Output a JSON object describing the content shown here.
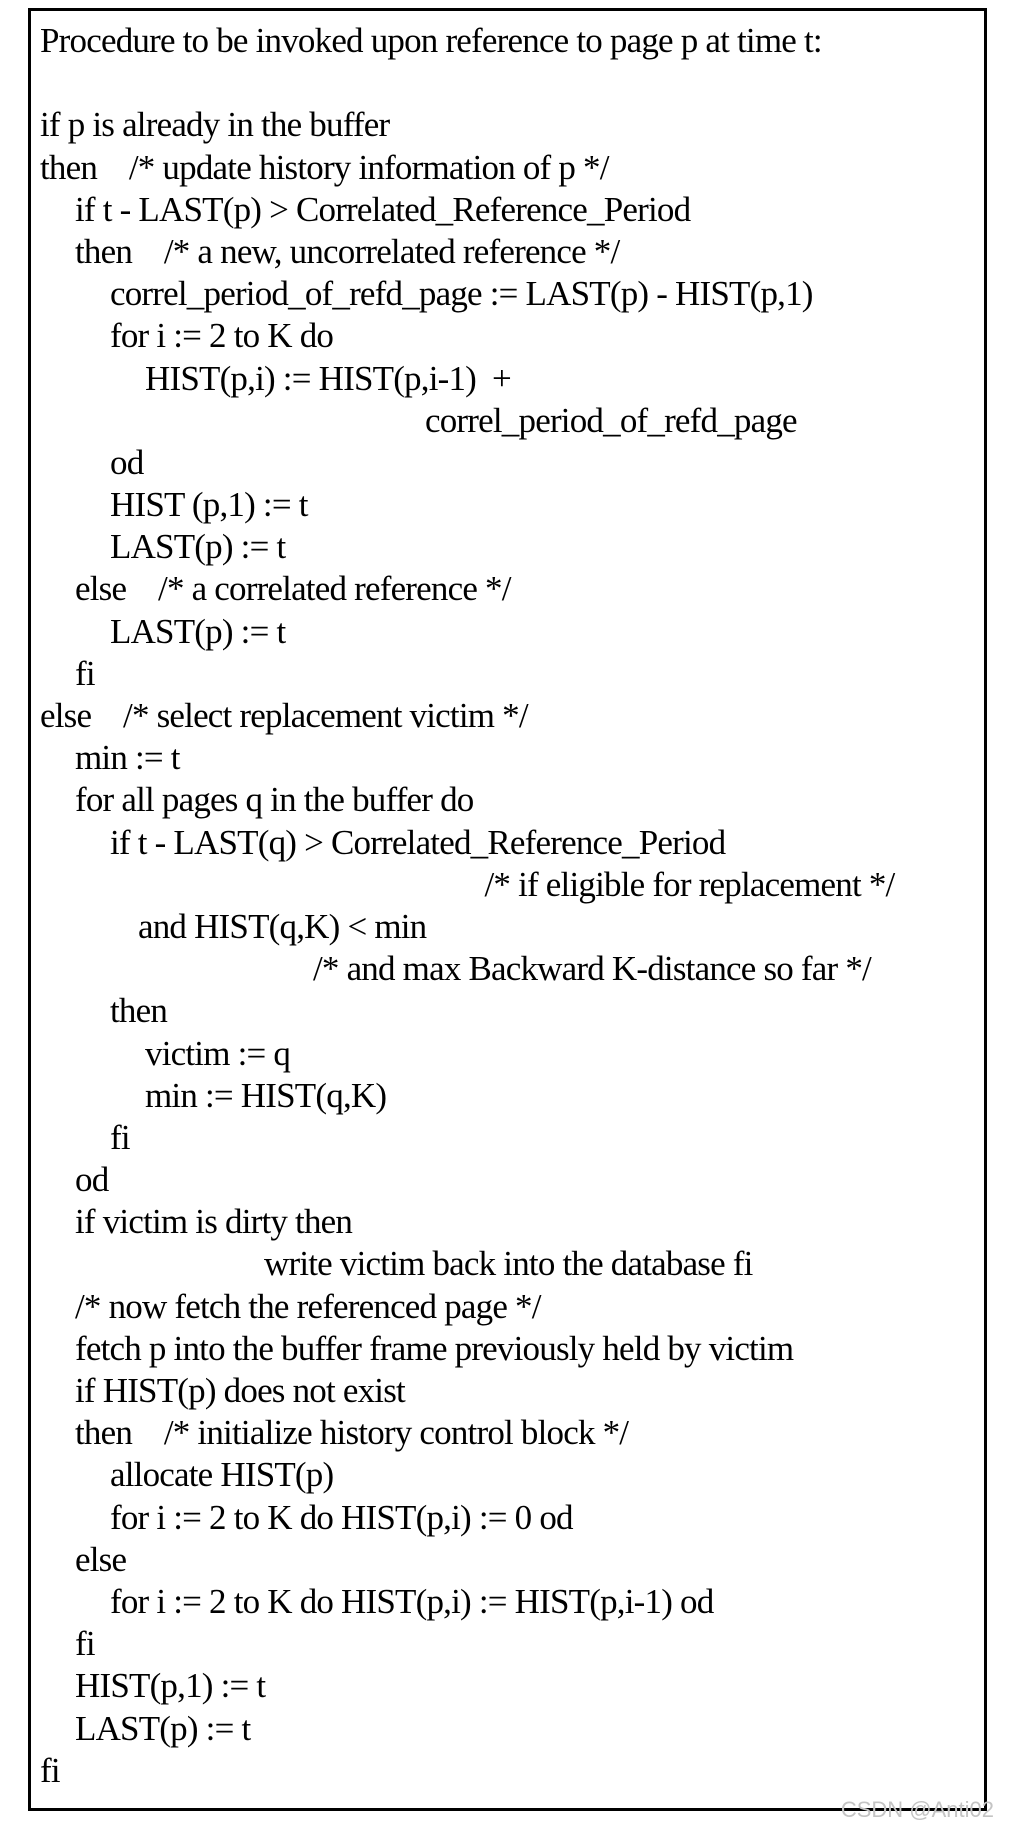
{
  "lines": [
    {
      "indent": 0,
      "text": "Procedure to be invoked upon reference to page p at time t:"
    },
    {
      "indent": 0,
      "text": ""
    },
    {
      "indent": 0,
      "text": "if p is already in the buffer"
    },
    {
      "indent": 0,
      "text": "then    /* update history information of p */"
    },
    {
      "indent": 1,
      "text": "if t - LAST(p) > Correlated_Reference_Period"
    },
    {
      "indent": 1,
      "text": "then    /* a new, uncorrelated reference */"
    },
    {
      "indent": 2,
      "text": "correl_period_of_refd_page := LAST(p) - HIST(p,1)"
    },
    {
      "indent": 2,
      "text": "for i := 2 to K do"
    },
    {
      "indent": 3,
      "text": "HIST(p,i) := HIST(p,i-1)  +"
    },
    {
      "indent": 11,
      "text": "correl_period_of_refd_page"
    },
    {
      "indent": 2,
      "text": "od"
    },
    {
      "indent": 2,
      "text": "HIST (p,1) := t"
    },
    {
      "indent": 2,
      "text": "LAST(p) := t"
    },
    {
      "indent": 1,
      "text": "else    /* a correlated reference */"
    },
    {
      "indent": 2,
      "text": "LAST(p) := t"
    },
    {
      "indent": 1,
      "text": "fi"
    },
    {
      "indent": 0,
      "text": "else    /* select replacement victim */"
    },
    {
      "indent": 1,
      "text": "min := t"
    },
    {
      "indent": 1,
      "text": "for all pages q in the buffer do"
    },
    {
      "indent": 2,
      "text": "if t - LAST(q) > Correlated_Reference_Period"
    },
    {
      "indent": 12.7,
      "text": "/* if eligible for replacement */"
    },
    {
      "indent": 2.8,
      "text": "and HIST(q,K) < min"
    },
    {
      "indent": 7.8,
      "text": "/* and max Backward K-distance so far */"
    },
    {
      "indent": 2,
      "text": "then"
    },
    {
      "indent": 3,
      "text": "victim := q"
    },
    {
      "indent": 3,
      "text": "min := HIST(q,K)"
    },
    {
      "indent": 2,
      "text": "fi"
    },
    {
      "indent": 1,
      "text": "od"
    },
    {
      "indent": 1,
      "text": "if victim is dirty then"
    },
    {
      "indent": 6.4,
      "text": "write victim back into the database fi"
    },
    {
      "indent": 1,
      "text": "/* now fetch the referenced page */"
    },
    {
      "indent": 1,
      "text": "fetch p into the buffer frame previously held by victim"
    },
    {
      "indent": 1,
      "text": "if HIST(p) does not exist"
    },
    {
      "indent": 1,
      "text": "then    /* initialize history control block */"
    },
    {
      "indent": 2,
      "text": "allocate HIST(p)"
    },
    {
      "indent": 2,
      "text": "for i := 2 to K do HIST(p,i) := 0 od"
    },
    {
      "indent": 1,
      "text": "else"
    },
    {
      "indent": 2,
      "text": "for i := 2 to K do HIST(p,i) := HIST(p,i-1) od"
    },
    {
      "indent": 1,
      "text": "fi"
    },
    {
      "indent": 1,
      "text": "HIST(p,1) := t"
    },
    {
      "indent": 1,
      "text": "LAST(p) := t"
    },
    {
      "indent": 0,
      "text": "fi"
    }
  ],
  "watermark": "CSDN @Anti02"
}
